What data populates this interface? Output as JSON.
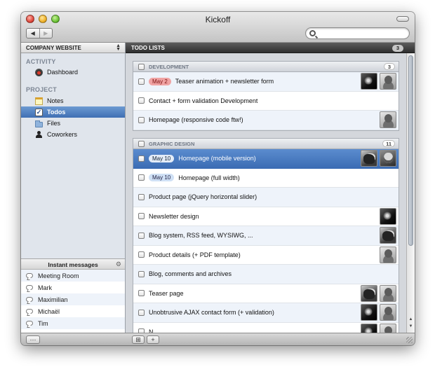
{
  "window": {
    "title": "Kickoff"
  },
  "toolbar": {
    "back_glyph": "◀",
    "forward_glyph": "▶",
    "search_placeholder": ""
  },
  "sidebar": {
    "project": "COMPANY WEBSITE",
    "activity_heading": "ACTIVITY",
    "activity_items": [
      {
        "label": "Dashboard",
        "icon": "dashboard-icon"
      }
    ],
    "project_heading": "PROJECT",
    "project_items": [
      {
        "label": "Notes",
        "icon": "notes-icon"
      },
      {
        "label": "Todos",
        "icon": "todos-checkbox-icon",
        "active": true
      },
      {
        "label": "Files",
        "icon": "folder-icon"
      },
      {
        "label": "Coworkers",
        "icon": "person-icon"
      }
    ]
  },
  "im": {
    "heading": "Instant messages",
    "items": [
      "Meeting Room",
      "Mark",
      "Maximilian",
      "Michaël",
      "Tim"
    ]
  },
  "main": {
    "heading": "TODO LISTS",
    "count": "3",
    "groups": [
      {
        "name": "DEVELOPMENT",
        "count": "3",
        "items": [
          {
            "date": "May 2",
            "date_style": "red",
            "text": "Teaser animation + newsletter form",
            "avatars": [
              "av-dark",
              "av-light"
            ]
          },
          {
            "date": "",
            "text": "Contact + form validation Development",
            "avatars": []
          },
          {
            "date": "",
            "text": "Homepage (responsive code ftw!)",
            "avatars": [
              "av-light"
            ]
          }
        ]
      },
      {
        "name": "GRAPHIC DESIGN",
        "count": "11",
        "items": [
          {
            "date": "May 10",
            "date_style": "blue",
            "text": "Homepage (mobile version)",
            "avatars": [
              "av-dog",
              "av-face"
            ],
            "selected": true
          },
          {
            "date": "May 10",
            "date_style": "blue",
            "text": "Homepage (full width)",
            "avatars": []
          },
          {
            "date": "",
            "text": "Product page (jQuery horizontal slider)",
            "avatars": []
          },
          {
            "date": "",
            "text": "Newsletter design",
            "avatars": [
              "av-dark"
            ]
          },
          {
            "date": "",
            "text": "Blog system, RSS feed, WYSIWG, ...",
            "avatars": [
              "av-dog"
            ]
          },
          {
            "date": "",
            "text": "Product details (+ PDF template)",
            "avatars": [
              "av-light"
            ]
          },
          {
            "date": "",
            "text": "Blog, comments and archives",
            "avatars": []
          },
          {
            "date": "",
            "text": "Teaser page",
            "avatars": [
              "av-dog",
              "av-light"
            ]
          },
          {
            "date": "",
            "text": "Unobtrusive AJAX contact form (+ validation)",
            "avatars": [
              "av-dark",
              "av-light"
            ]
          },
          {
            "date": "",
            "text": "N...",
            "avatars": [
              "av-dark",
              "av-light"
            ]
          }
        ]
      }
    ]
  },
  "bottom": {
    "left_button": "⋯",
    "add_list_button": "⊞",
    "add_button": "+"
  }
}
